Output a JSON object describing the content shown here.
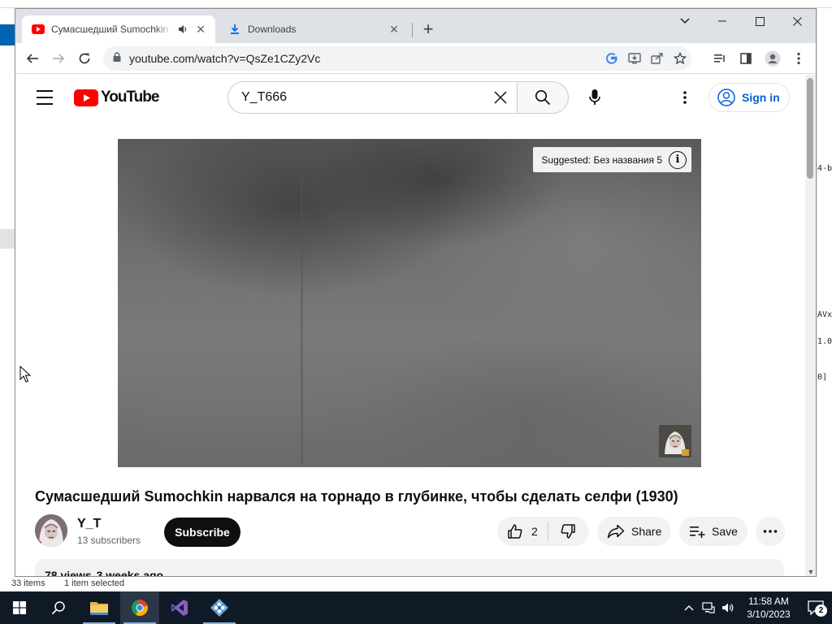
{
  "background_window": {
    "status_items": "33 items",
    "status_selected": "1 item selected",
    "right_fragments": [
      "4-b",
      "AVx",
      "1.0",
      "0]"
    ]
  },
  "browser": {
    "tabs": [
      {
        "title": "Сумасшедший Sumochkin нарвался на торнадо",
        "icon": "youtube-icon",
        "active": true
      },
      {
        "title": "Downloads",
        "icon": "download-icon",
        "active": false
      }
    ],
    "url": "youtube.com/watch?v=QsZe1CZy2Vc"
  },
  "youtube": {
    "logo_text": "YouTube",
    "search_query": "Y_T666",
    "sign_in_label": "Sign in",
    "player": {
      "suggested_label": "Suggested: Без названия 5",
      "info_glyph": "i"
    },
    "video_title": "Сумасшедший Sumochkin нарвался на торнадо в глубинке, чтобы сделать селфи (1930)",
    "channel": {
      "name": "Y_T",
      "subscribers": "13 subscribers",
      "subscribe_label": "Subscribe"
    },
    "actions": {
      "likes": "2",
      "share_label": "Share",
      "save_label": "Save"
    },
    "description": {
      "views": "78 views",
      "date": "3 weeks ago"
    }
  },
  "taskbar": {
    "time": "11:58 AM",
    "date": "3/10/2023",
    "notification_count": "2"
  },
  "colors": {
    "youtube_red": "#ff0000",
    "link_blue": "#065fd4",
    "taskbar": "#101a26",
    "tab_strip": "#dee1e6"
  }
}
